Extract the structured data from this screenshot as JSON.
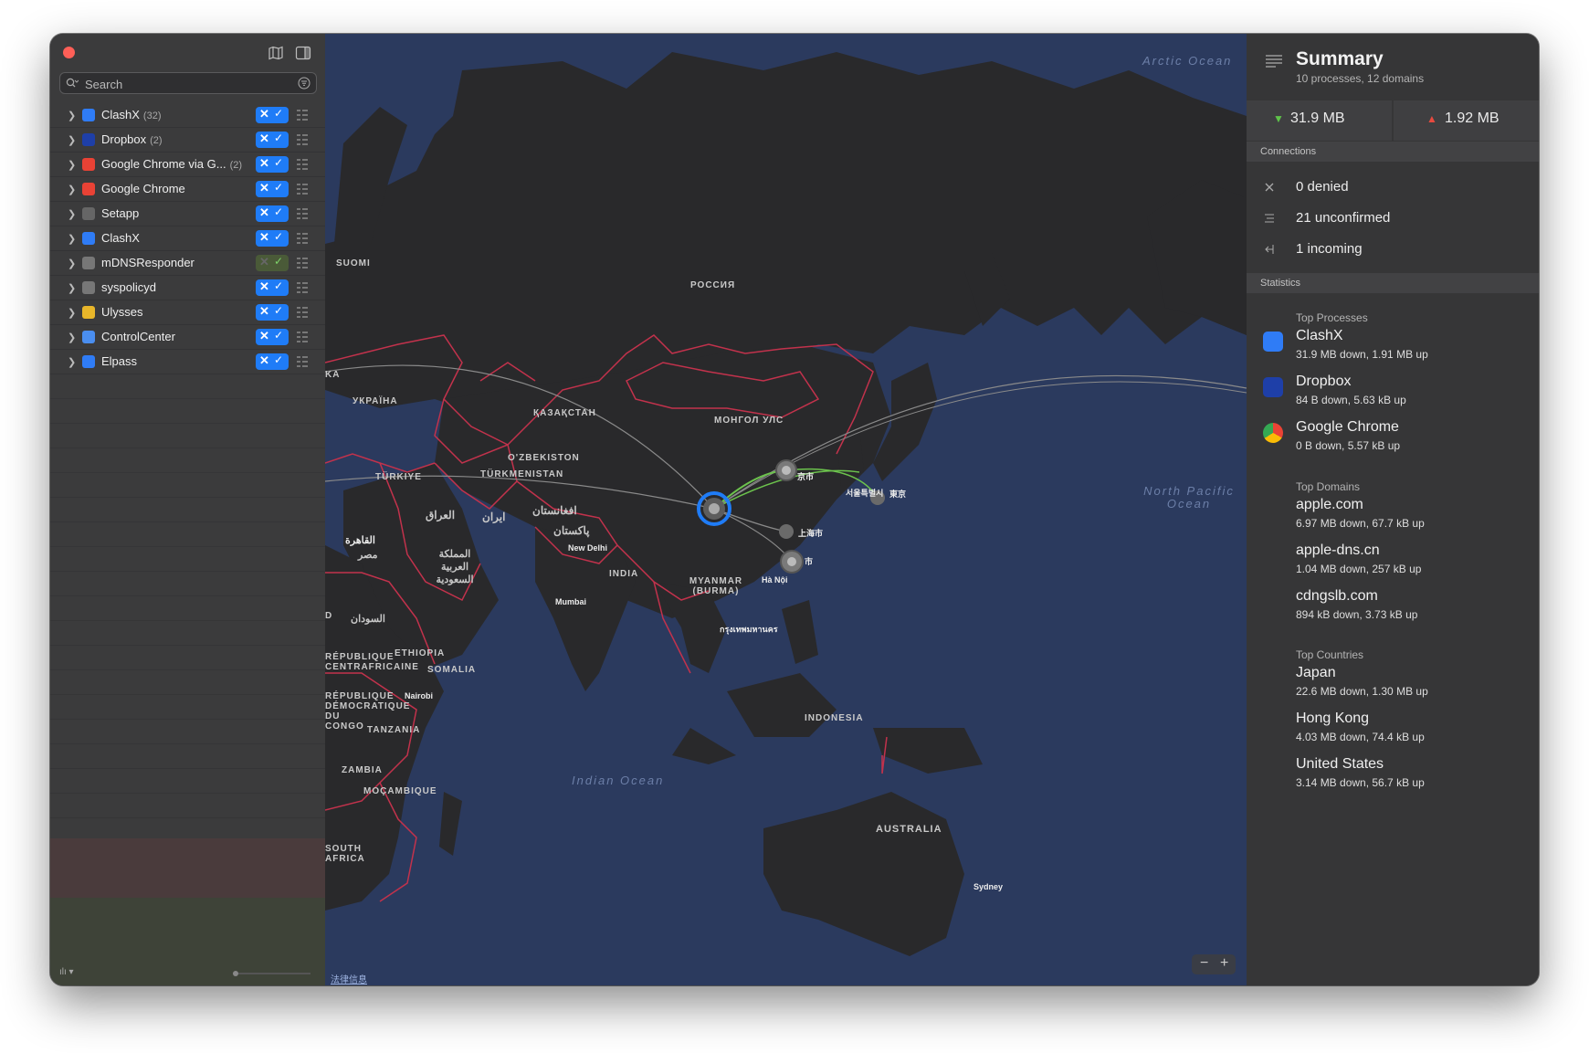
{
  "sidebar": {
    "search_placeholder": "Search",
    "processes": [
      {
        "name": "ClashX",
        "count": "(32)",
        "icon": "clashx-icon",
        "color": "#2f7cf6",
        "state": "on"
      },
      {
        "name": "Dropbox",
        "count": "(2)",
        "icon": "dropbox-icon",
        "color": "#1e3fa8",
        "state": "on"
      },
      {
        "name": "Google Chrome via G...",
        "count": "(2)",
        "icon": "chrome-icon",
        "color": "#e94235",
        "state": "on"
      },
      {
        "name": "Google Chrome",
        "count": "",
        "icon": "chrome-icon",
        "color": "#e94235",
        "state": "on"
      },
      {
        "name": "Setapp",
        "count": "",
        "icon": "setapp-icon",
        "color": "#666666",
        "state": "on"
      },
      {
        "name": "ClashX",
        "count": "",
        "icon": "clashx-icon",
        "color": "#2f7cf6",
        "state": "on"
      },
      {
        "name": "mDNSResponder",
        "count": "",
        "icon": "gear-icon",
        "color": "#777777",
        "state": "partial"
      },
      {
        "name": "syspolicyd",
        "count": "",
        "icon": "gear-icon",
        "color": "#777777",
        "state": "on"
      },
      {
        "name": "Ulysses",
        "count": "",
        "icon": "ulysses-icon",
        "color": "#e8b62a",
        "state": "on"
      },
      {
        "name": "ControlCenter",
        "count": "",
        "icon": "controlcenter-icon",
        "color": "#4a8ef0",
        "state": "on"
      },
      {
        "name": "Elpass",
        "count": "",
        "icon": "elpass-icon",
        "color": "#2f7cf6",
        "state": "on"
      }
    ]
  },
  "map": {
    "labels": {
      "russia": "РОССИЯ",
      "mongolia": "МОНГОЛ УЛС",
      "kazakhstan": "ҚАЗАҚСТАН",
      "ukraine": "УКРАЇНА",
      "suomi": "SUOMI",
      "turkiye": "TÜRKIYE",
      "uzbekistan": "O'ZBEKISTON",
      "turkmenistan": "TÜRKMENISTAN",
      "iraq": "العراق",
      "iran": "ایران",
      "afghanistan": "افغانستان",
      "pakistan": "پاکستان",
      "egypt": "مصر",
      "saudi": "المملكة العربية السعودية",
      "sudan": "السودان",
      "ethiopia": "ETHIOPIA",
      "somalia": "SOMALIA",
      "tanzania": "TANZANIA",
      "zambia": "ZAMBIA",
      "mozambique": "MOÇAMBIQUE",
      "south_africa": "SOUTH AFRICA",
      "india": "INDIA",
      "myanmar": "MYANMAR (BURMA)",
      "indonesia": "INDONESIA",
      "australia": "AUSTRALIA",
      "rdc": "RÉPUBLIQUE DÉMOCRATIQUE DU CONGO",
      "car": "RÉPUBLIQUE CENTRAFRICAINE",
      "ka": "KA",
      "d": "D"
    },
    "oceans": {
      "arctic": "Arctic Ocean",
      "indian": "Indian Ocean",
      "pacific": "North Pacific Ocean"
    },
    "cities": {
      "cairo": "القاهرة",
      "delhi": "New Delhi",
      "mumbai": "Mumbai",
      "hanoi": "Hà Nội",
      "bangkok": "กรุงเทพมหานคร",
      "nairobi": "Nairobi",
      "sydney": "Sydney",
      "beijing": "京市",
      "seoul": "서울특별시",
      "tokyo": "東京",
      "shanghai": "上海市",
      "hk": "市"
    },
    "legal": "法律信息",
    "zoom_out": "−",
    "zoom_in": "+"
  },
  "summary": {
    "title": "Summary",
    "subtitle": "10 processes, 12 domains",
    "down": "31.9 MB",
    "up": "1.92 MB",
    "connections_header": "Connections",
    "denied": "0 denied",
    "unconfirmed": "21 unconfirmed",
    "incoming": "1 incoming",
    "statistics_header": "Statistics",
    "top_processes_label": "Top Processes",
    "top_processes": [
      {
        "name": "ClashX",
        "detail": "31.9 MB down, 1.91 MB up",
        "icon": "clashx-icon"
      },
      {
        "name": "Dropbox",
        "detail": "84 B down, 5.63 kB up",
        "icon": "dropbox-icon"
      },
      {
        "name": "Google Chrome",
        "detail": "0 B down, 5.57 kB up",
        "icon": "chrome-icon"
      }
    ],
    "top_domains_label": "Top Domains",
    "top_domains": [
      {
        "name": "apple.com",
        "detail": "6.97 MB down, 67.7 kB up"
      },
      {
        "name": "apple-dns.cn",
        "detail": "1.04 MB down, 257 kB up"
      },
      {
        "name": "cdngslb.com",
        "detail": "894 kB down, 3.73 kB up"
      }
    ],
    "top_countries_label": "Top Countries",
    "top_countries": [
      {
        "name": "Japan",
        "detail": "22.6 MB down, 1.30 MB up"
      },
      {
        "name": "Hong Kong",
        "detail": "4.03 MB down, 74.4 kB up"
      },
      {
        "name": "United States",
        "detail": "3.14 MB down, 56.7 kB up"
      }
    ]
  },
  "colors": {
    "accent": "#1f7cf7",
    "down": "#5fc34a",
    "up": "#e84a3f",
    "border": "#c2324c",
    "land": "#2a2a2c",
    "ocean": "#2b3a5e"
  }
}
